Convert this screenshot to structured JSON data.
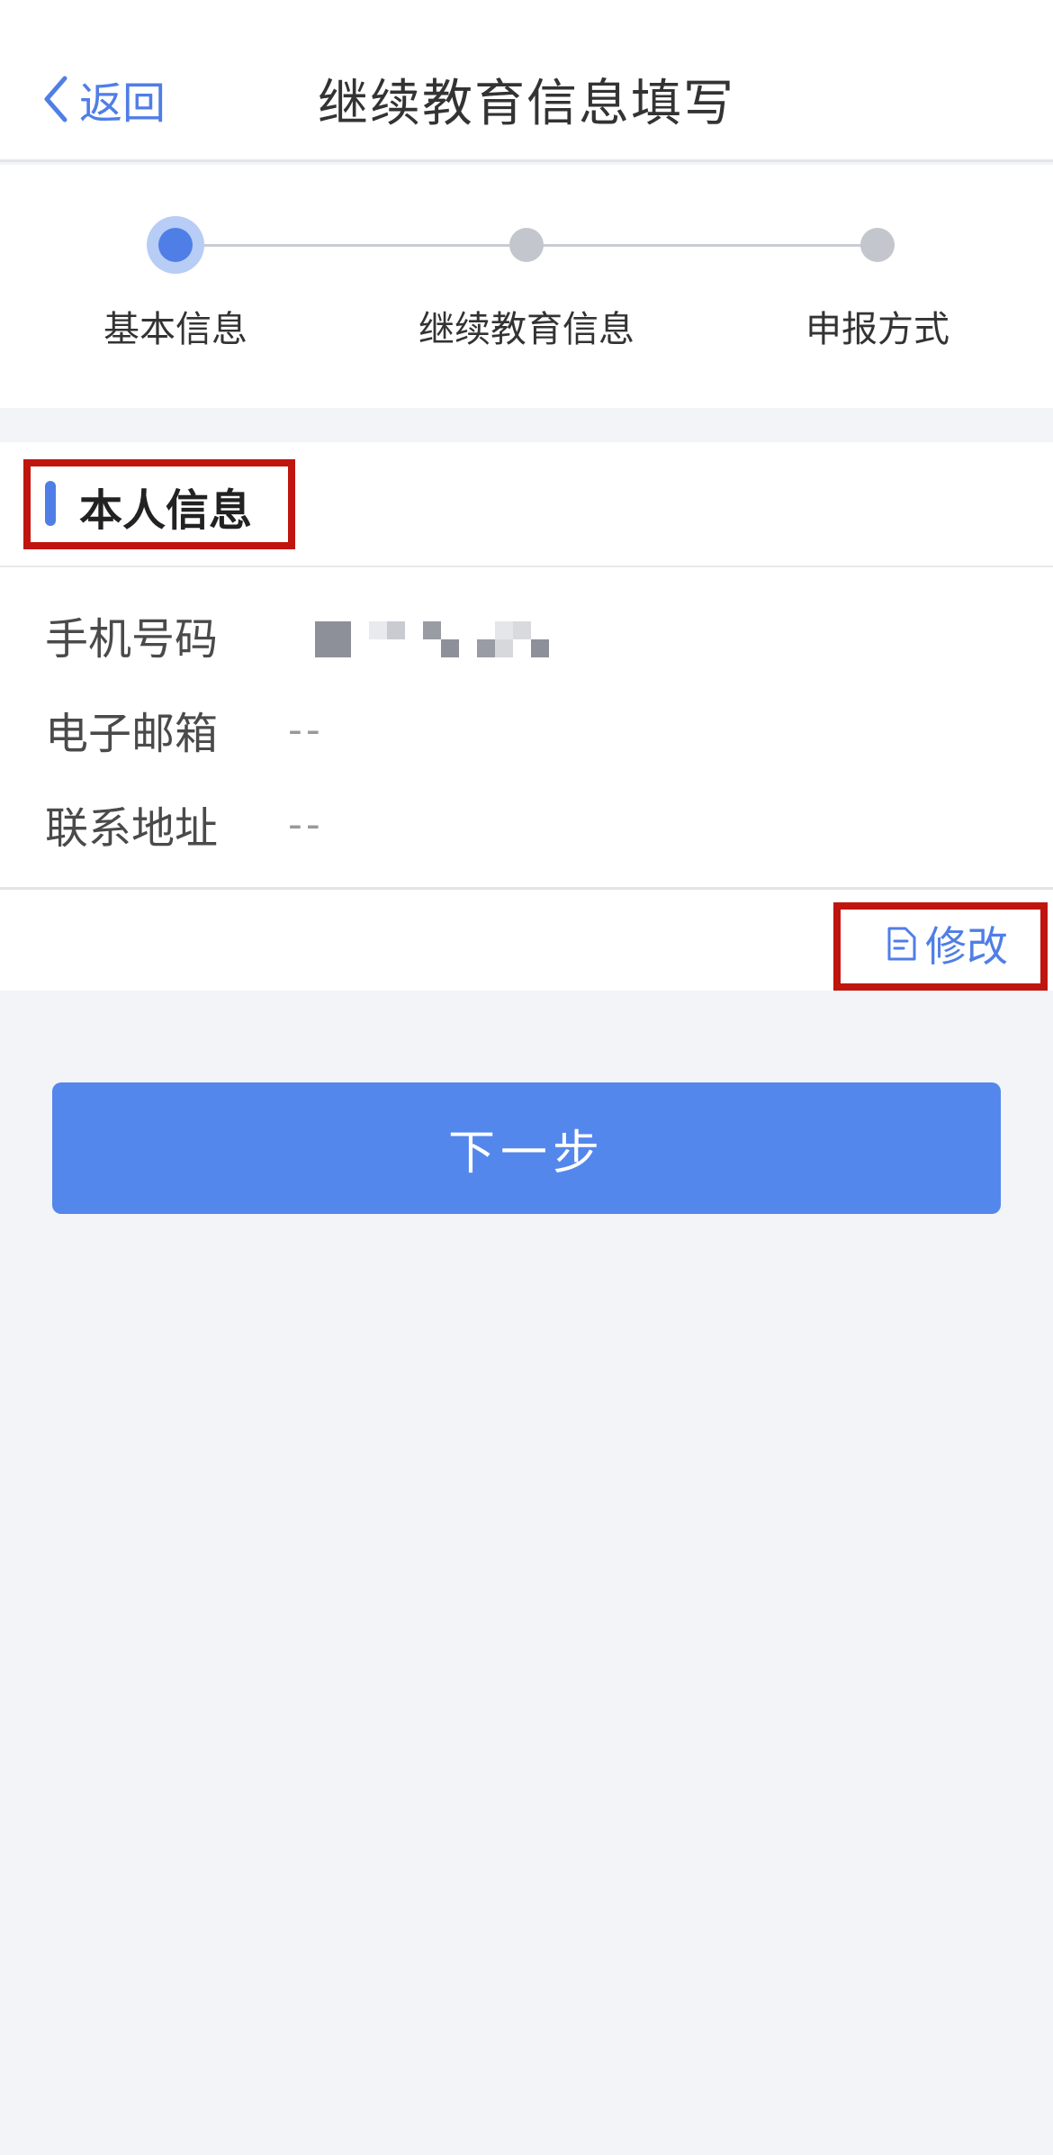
{
  "header": {
    "back_label": "返回",
    "title": "继续教育信息填写"
  },
  "steps": [
    {
      "label": "基本信息",
      "active": true
    },
    {
      "label": "继续教育信息",
      "active": false
    },
    {
      "label": "申报方式",
      "active": false
    }
  ],
  "personal_info": {
    "section_title": "本人信息",
    "rows": [
      {
        "label": "手机号码",
        "value": ""
      },
      {
        "label": "电子邮箱",
        "value": "--"
      },
      {
        "label": "联系地址",
        "value": "--"
      }
    ],
    "edit_label": "修改"
  },
  "next_button_label": "下一步",
  "colors": {
    "accent": "#4f7ee6",
    "button": "#5487ec",
    "highlight": "#c0150f",
    "background": "#f2f4f8"
  }
}
